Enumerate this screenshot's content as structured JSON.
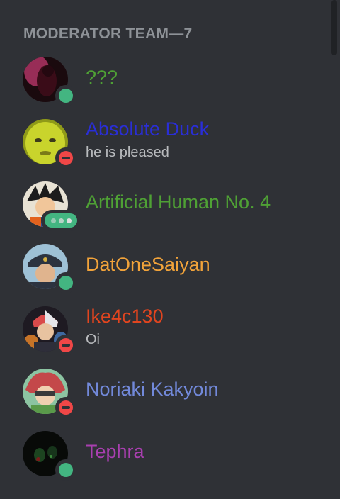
{
  "section": {
    "header": "MODERATOR TEAM—7"
  },
  "members": [
    {
      "name": "???",
      "color": "#4fa135",
      "status": "online",
      "subtext": ""
    },
    {
      "name": "Absolute Duck",
      "color": "#2a2ed6",
      "status": "dnd",
      "subtext": "he is pleased"
    },
    {
      "name": "Artificial Human No. 4",
      "color": "#4fa135",
      "status": "typing",
      "subtext": ""
    },
    {
      "name": "DatOneSaiyan",
      "color": "#f2a33a",
      "status": "online",
      "subtext": ""
    },
    {
      "name": "Ike4c130",
      "color": "#e2451f",
      "status": "dnd",
      "subtext": "Oi"
    },
    {
      "name": "Noriaki Kakyoin",
      "color": "#7289da",
      "status": "dnd",
      "subtext": ""
    },
    {
      "name": "Tephra",
      "color": "#a93fb0",
      "status": "online",
      "subtext": ""
    }
  ]
}
